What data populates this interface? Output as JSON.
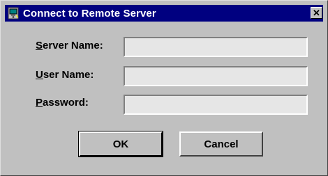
{
  "window": {
    "title": "Connect to Remote Server",
    "icon": "network-computer-icon",
    "close_glyph": "✕",
    "colors": {
      "titlebar": "#000080",
      "face": "#c0c0c0",
      "input_bg": "#e6e6e6"
    }
  },
  "form": {
    "server_name": {
      "label_mnemonic": "S",
      "label_rest": "erver Name:",
      "value": ""
    },
    "user_name": {
      "label_mnemonic": "U",
      "label_rest": "ser Name:",
      "value": ""
    },
    "password": {
      "label_mnemonic": "P",
      "label_rest": "assword:",
      "value": ""
    }
  },
  "buttons": {
    "ok_label": "OK",
    "cancel_label": "Cancel"
  }
}
